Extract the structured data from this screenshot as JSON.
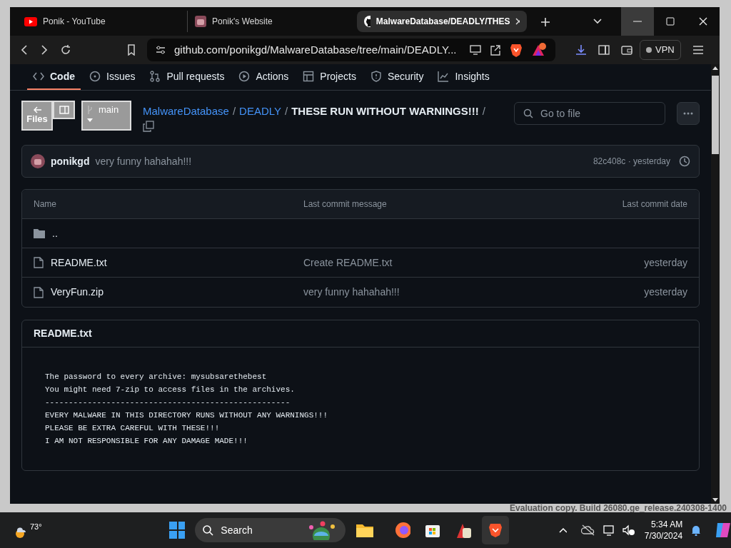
{
  "browser": {
    "tabs": [
      {
        "kind": "youtube",
        "title": "Ponik - YouTube",
        "selected": false
      },
      {
        "kind": "avatar",
        "title": "Ponik's Website",
        "selected": false
      },
      {
        "kind": "github",
        "title": "MalwareDatabase/DEADLY/THES",
        "selected": true
      }
    ],
    "address": "github.com/ponikgd/MalwareDatabase/tree/main/DEADLY...",
    "vpn": "VPN"
  },
  "repo_nav": [
    {
      "kind": "code",
      "label": "Code",
      "selected": true
    },
    {
      "kind": "issues",
      "label": "Issues",
      "selected": false
    },
    {
      "kind": "pulls",
      "label": "Pull requests",
      "selected": false
    },
    {
      "kind": "actions",
      "label": "Actions",
      "selected": false
    },
    {
      "kind": "projects",
      "label": "Projects",
      "selected": false
    },
    {
      "kind": "security",
      "label": "Security",
      "selected": false
    },
    {
      "kind": "insights",
      "label": "Insights",
      "selected": false
    }
  ],
  "files_button": "Files",
  "branch": "main",
  "breadcrumb": [
    {
      "kind": "link",
      "text": "MalwareDatabase"
    },
    {
      "kind": "separator",
      "text": "/"
    },
    {
      "kind": "link",
      "text": "DEADLY"
    },
    {
      "kind": "separator",
      "text": "/"
    },
    {
      "kind": "current",
      "text": "THESE RUN WITHOUT WARNINGS!!!"
    },
    {
      "kind": "separator",
      "text": "/"
    }
  ],
  "go_to_file": {
    "placeholder": "Go to file"
  },
  "commit": {
    "author": "ponikgd",
    "message": "very funny hahahah!!!",
    "sha": "82c408c · yesterday"
  },
  "table": {
    "columns": [
      "Name",
      "Last commit message",
      "Last commit date"
    ],
    "rows": [
      {
        "kind": "parent",
        "name": ".."
      },
      {
        "kind": "file",
        "name": "README.txt",
        "message": "Create README.txt",
        "date": "yesterday"
      },
      {
        "kind": "file",
        "name": "VeryFun.zip",
        "message": "very funny hahahah!!!",
        "date": "yesterday"
      }
    ]
  },
  "readme": {
    "title": "README.txt",
    "lines": [
      "The password to every archive: mysubsarethebest",
      "You might need 7-zip to access files in the archives.",
      "----------------------------------------------------",
      "EVERY MALWARE IN THIS DIRECTORY RUNS WITHOUT ANY WARNINGS!!!",
      "PLEASE BE EXTRA CAREFUL WITH THESE!!!",
      "I AM NOT RESPONSIBLE FOR ANY DAMAGE MADE!!!"
    ]
  },
  "desktop": {
    "watermark": "Evaluation copy. Build 26080.ge_release.240308-1400"
  },
  "taskbar": {
    "weather": "73°",
    "search": "Search",
    "time": "5:34 AM",
    "date": "7/30/2024"
  }
}
